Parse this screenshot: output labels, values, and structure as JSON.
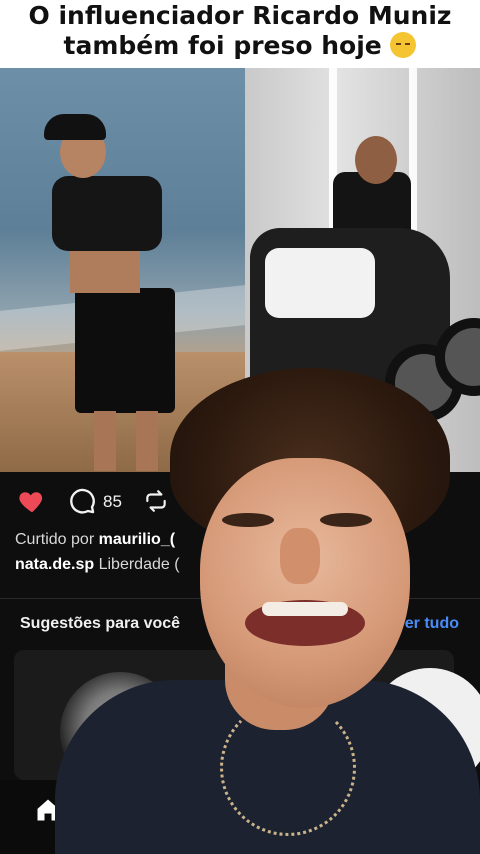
{
  "overlay_caption": {
    "line1": "O influenciador Ricardo Muniz",
    "line2": "também foi preso hoje",
    "emoji": "pensive-face"
  },
  "post": {
    "likes_state": "liked",
    "comment_count": "85",
    "liked_by_prefix": "Curtido por ",
    "liked_by_user": "maurilio_(",
    "caption_user": "nata.de.sp",
    "caption_text": " Liberdade (",
    "colors": {
      "like": "#ed4956",
      "link": "#4a8cf7",
      "background": "#0e0e0e"
    }
  },
  "suggestions": {
    "title": "Sugestões para você",
    "see_all": "Ver tudo"
  },
  "bottom_nav": {
    "home": "home-icon"
  }
}
